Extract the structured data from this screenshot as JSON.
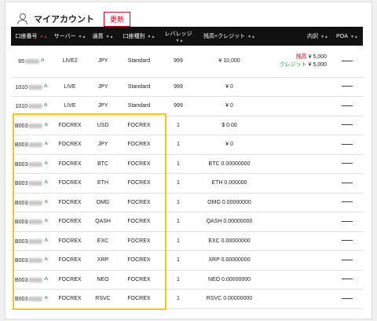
{
  "header": {
    "title": "マイアカウント",
    "refresh_label": "更新"
  },
  "columns": [
    "口座番号",
    "サーバー",
    "通貨",
    "口座種別",
    "レバレッジ",
    "残高+クレジット",
    "内訳",
    "POA"
  ],
  "first_row": {
    "account": "65",
    "server": "LIVE2",
    "currency": "JPY",
    "type": "Standard",
    "leverage": "999",
    "balance": "¥ 10,000",
    "breakdown_balance_label": "残高",
    "breakdown_balance_value": "¥ 5,000",
    "breakdown_credit_label": "クレジット",
    "breakdown_credit_value": "¥ 5,000"
  },
  "rows": [
    {
      "account": "1010",
      "server": "LIVE",
      "currency": "JPY",
      "type": "Standard",
      "leverage": "999",
      "balance": "¥ 0"
    },
    {
      "account": "1010",
      "server": "LIVE",
      "currency": "JPY",
      "type": "Standard",
      "leverage": "999",
      "balance": "¥ 0"
    },
    {
      "account": "B003",
      "server": "FOCREX",
      "currency": "USD",
      "type": "FOCREX",
      "leverage": "1",
      "balance": "$ 0.00"
    },
    {
      "account": "B003",
      "server": "FOCREX",
      "currency": "JPY",
      "type": "FOCREX",
      "leverage": "1",
      "balance": "¥ 0"
    },
    {
      "account": "B003",
      "server": "FOCREX",
      "currency": "BTC",
      "type": "FOCREX",
      "leverage": "1",
      "balance": "BTC 0.00000000"
    },
    {
      "account": "B003",
      "server": "FOCREX",
      "currency": "ETH",
      "type": "FOCREX",
      "leverage": "1",
      "balance": "ETH 0.000000"
    },
    {
      "account": "B003",
      "server": "FOCREX",
      "currency": "OMG",
      "type": "FOCREX",
      "leverage": "1",
      "balance": "OMG 0.00000000"
    },
    {
      "account": "B003",
      "server": "FOCREX",
      "currency": "QASH",
      "type": "FOCREX",
      "leverage": "1",
      "balance": "QASH 0.00000000"
    },
    {
      "account": "B003",
      "server": "FOCREX",
      "currency": "EXC",
      "type": "FOCREX",
      "leverage": "1",
      "balance": "EXC 0.00000000"
    },
    {
      "account": "B003",
      "server": "FOCREX",
      "currency": "XRP",
      "type": "FOCREX",
      "leverage": "1",
      "balance": "XRP 0.00000000"
    },
    {
      "account": "B003",
      "server": "FOCREX",
      "currency": "NEO",
      "type": "FOCREX",
      "leverage": "1",
      "balance": "NEO 0.00000000"
    },
    {
      "account": "B003",
      "server": "FOCREX",
      "currency": "RSVC",
      "type": "FOCREX",
      "leverage": "1",
      "balance": "RSVC 0.00000000"
    }
  ],
  "colors": {
    "accent": "#d0021b",
    "expand": "#2e9e44",
    "highlight": "#f5c518",
    "header_bg": "#111111"
  }
}
